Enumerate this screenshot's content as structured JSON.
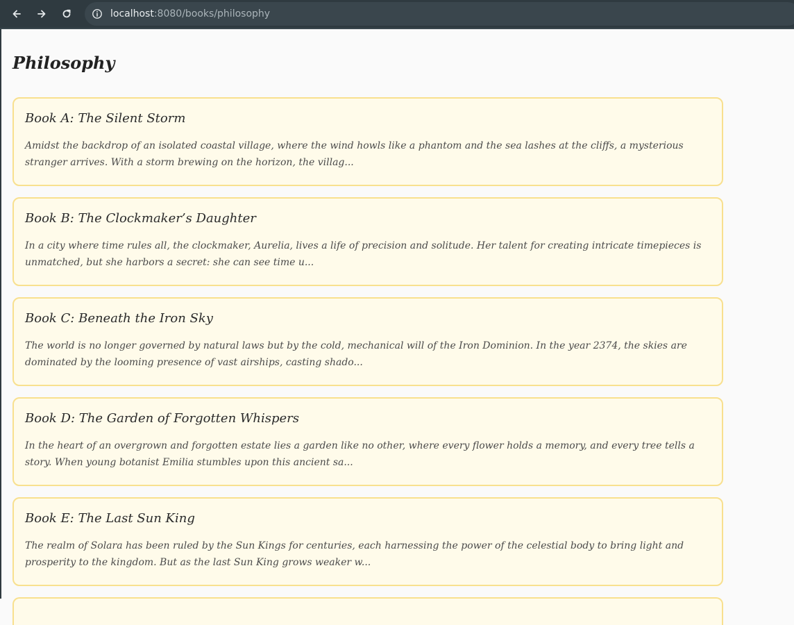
{
  "browser": {
    "url_host": "localhost",
    "url_path": ":8080/books/philosophy"
  },
  "page": {
    "title": "Philosophy"
  },
  "books": [
    {
      "title": "Book A: The Silent Storm",
      "description": "Amidst the backdrop of an isolated coastal village, where the wind howls like a phantom and the sea lashes at the cliffs, a mysterious stranger arrives. With a storm brewing on the horizon, the villag..."
    },
    {
      "title": "Book B: The Clockmaker’s Daughter",
      "description": "In a city where time rules all, the clockmaker, Aurelia, lives a life of precision and solitude. Her talent for creating intricate timepieces is unmatched, but she harbors a secret: she can see time u..."
    },
    {
      "title": "Book C: Beneath the Iron Sky",
      "description": "The world is no longer governed by natural laws but by the cold, mechanical will of the Iron Dominion. In the year 2374, the skies are dominated by the looming presence of vast airships, casting shado..."
    },
    {
      "title": "Book D: The Garden of Forgotten Whispers",
      "description": "In the heart of an overgrown and forgotten estate lies a garden like no other, where every flower holds a memory, and every tree tells a story. When young botanist Emilia stumbles upon this ancient sa..."
    },
    {
      "title": "Book E: The Last Sun King",
      "description": "The realm of Solara has been ruled by the Sun Kings for centuries, each harnessing the power of the celestial body to bring light and prosperity to the kingdom. But as the last Sun King grows weaker w..."
    }
  ],
  "icons": {
    "back": "arrow-left-icon",
    "forward": "arrow-right-icon",
    "reload": "reload-icon",
    "site_info": "info-icon"
  },
  "colors": {
    "card_border": "#f8e08e",
    "card_background": "#fffbea",
    "toolbar": "#2f3a40"
  }
}
